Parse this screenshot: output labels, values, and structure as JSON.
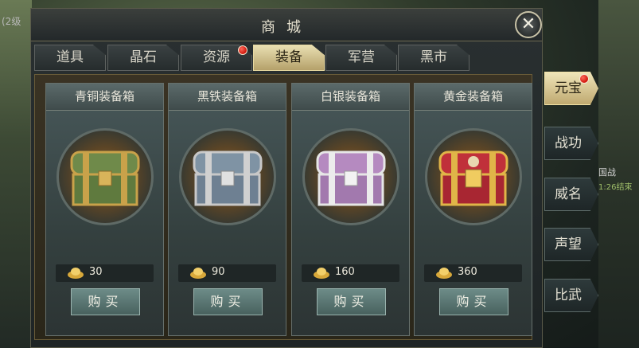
{
  "background": {
    "left_text": "(2级",
    "right_label": "国战",
    "right_sub": "1:26结束"
  },
  "window": {
    "title": "商城",
    "close_icon": "close-icon"
  },
  "tabs": [
    {
      "label": "道具",
      "active": false,
      "badge": false
    },
    {
      "label": "晶石",
      "active": false,
      "badge": false
    },
    {
      "label": "资源",
      "active": false,
      "badge": true
    },
    {
      "label": "装备",
      "active": true,
      "badge": false
    },
    {
      "label": "军营",
      "active": false,
      "badge": false
    },
    {
      "label": "黑市",
      "active": false,
      "badge": false
    }
  ],
  "items": [
    {
      "name": "青铜装备箱",
      "price": "30",
      "buy": "购买",
      "color": "#6f8a4a",
      "trim": "#c9a24a"
    },
    {
      "name": "黑铁装备箱",
      "price": "90",
      "buy": "购买",
      "color": "#7f93a4",
      "trim": "#c8c8c8"
    },
    {
      "name": "白银装备箱",
      "price": "160",
      "buy": "购买",
      "color": "#b58ac0",
      "trim": "#e6e6e6"
    },
    {
      "name": "黄金装备箱",
      "price": "360",
      "buy": "购买",
      "color": "#c0303a",
      "trim": "#e0b548"
    }
  ],
  "side_tabs": [
    {
      "label": "元宝",
      "active": true,
      "badge": true
    },
    {
      "label": "战功",
      "active": false,
      "badge": false
    },
    {
      "label": "威名",
      "active": false,
      "badge": false
    },
    {
      "label": "声望",
      "active": false,
      "badge": false
    },
    {
      "label": "比武",
      "active": false,
      "badge": false
    }
  ],
  "currency_icon": "gold-ingot-icon"
}
